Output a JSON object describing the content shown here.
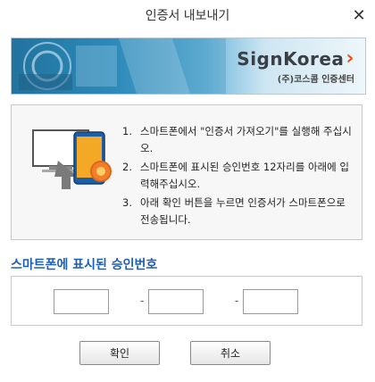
{
  "window": {
    "title": "인증서 내보내기",
    "close_glyph": "✕"
  },
  "banner": {
    "brand_name": "SignKorea",
    "brand_chevron": "›",
    "brand_sub": "(주)코스콤 인증센터",
    "accent_color": "#e8531c"
  },
  "instructions": {
    "steps": [
      {
        "num": "1.",
        "text": "스마트폰에서 \"인증서 가져오기\"를 실행해 주십시오."
      },
      {
        "num": "2.",
        "text": "스마트폰에 표시된 승인번호 12자리를 아래에 입력해주십시오."
      },
      {
        "num": "3.",
        "text": "아래 확인 버튼을 누르면 인증서가 스마트폰으로 전송됩니다."
      }
    ]
  },
  "approval": {
    "title": "스마트폰에 표시된 승인번호",
    "separator": "-",
    "fields": [
      "",
      "",
      ""
    ],
    "title_color": "#1b5fb7"
  },
  "buttons": {
    "confirm": "확인",
    "cancel": "취소"
  }
}
